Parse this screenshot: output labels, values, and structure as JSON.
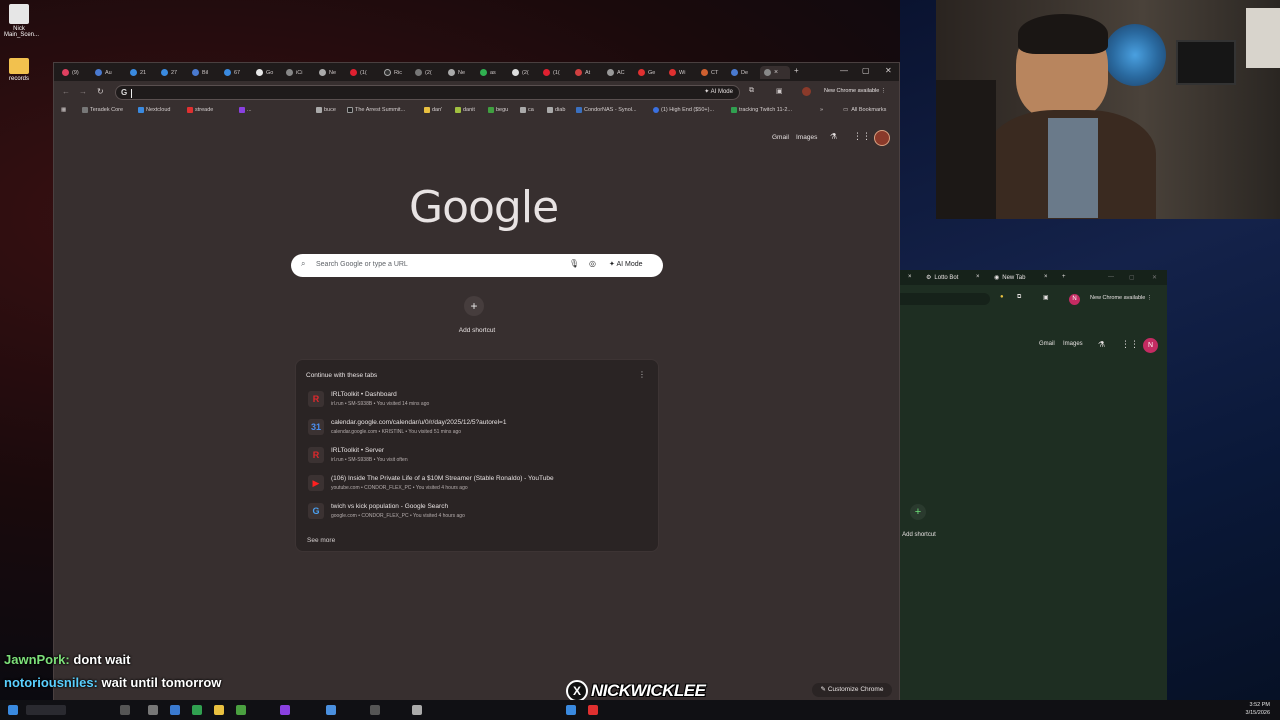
{
  "desktop": {
    "icons": [
      {
        "label": "Nick Main_Scen..."
      },
      {
        "label": "records"
      }
    ]
  },
  "browser": {
    "tabs": [
      "(9)",
      "Au",
      "21",
      "27",
      "Bil",
      "67",
      "Go",
      "iCi",
      "Ne",
      "(1(",
      "Ric",
      "(2(",
      "Ne",
      "as",
      "(2(",
      "(1(",
      "At",
      "AC",
      "Ge",
      "Wi",
      "CT",
      "De"
    ],
    "omnibox": {
      "placeholder": "",
      "ai_mode_label": "AI Mode"
    },
    "new_chrome_label": "New Chrome available",
    "bookmarks": [
      "Teradek Core",
      "Nextcloud",
      "streade",
      "...",
      "buce",
      "The Arrest Summit...",
      "dan'",
      "danit",
      "begu",
      "ca",
      "diab",
      "CondorNAS - Synol...",
      "(1) High End ($50+)...",
      "tracking Twitch 11-2...",
      "All Bookmarks"
    ]
  },
  "ntp": {
    "gmail_label": "Gmail",
    "images_label": "Images",
    "logo": "Google",
    "search_placeholder": "Search Google or type a URL",
    "ai_mode_label": "AI Mode",
    "add_shortcut_label": "Add shortcut",
    "continue_header": "Continue with these tabs",
    "continue_items": [
      {
        "title": "IRLToolkit • Dashboard",
        "sub": "irl.run • SM-S938B • You visited 14 mins ago",
        "icon": "R",
        "color": "#e0282c"
      },
      {
        "title": "calendar.google.com/calendar/u/0/r/day/2025/12/5?autorel=1",
        "sub": "calendar.google.com • KRISTINL • You visited 51 mins ago",
        "icon": "31",
        "color": "#4a8ef0"
      },
      {
        "title": "IRLToolkit • Server",
        "sub": "irl.run • SM-S938B • You visit often",
        "icon": "R",
        "color": "#e0282c"
      },
      {
        "title": "(106) Inside The Private Life of a $10M Streamer (Stable Ronaldo) - YouTube",
        "sub": "youtube.com • CONDOR_FLEX_PC • You visited 4 hours ago",
        "icon": "▶",
        "color": "#ff2020"
      },
      {
        "title": "twich vs kick population - Google Search",
        "sub": "google.com • CONDOR_FLEX_PC • You visited 4 hours ago",
        "icon": "G",
        "color": "#4aa0f0"
      }
    ],
    "see_more_label": "See more",
    "customize_label": "Customize Chrome"
  },
  "second_window": {
    "tabs": [
      "Lotto Bot",
      "New Tab"
    ],
    "new_chrome_label": "New Chrome available",
    "gmail_label": "Gmail",
    "images_label": "Images",
    "avatar_letter": "N",
    "add_shortcut_label": "Add shortcut"
  },
  "chat": [
    {
      "user": "JawnPork:",
      "user_color": "#7de07a",
      "message": "dont wait"
    },
    {
      "user": "notoriousniles:",
      "user_color": "#5ad0ff",
      "message": "wait until tomorrow"
    }
  ],
  "brand": {
    "name": "NICKWICKLEE",
    "icon": "X"
  },
  "clock": {
    "time": "3:52 PM",
    "date": "3/15/2026"
  }
}
